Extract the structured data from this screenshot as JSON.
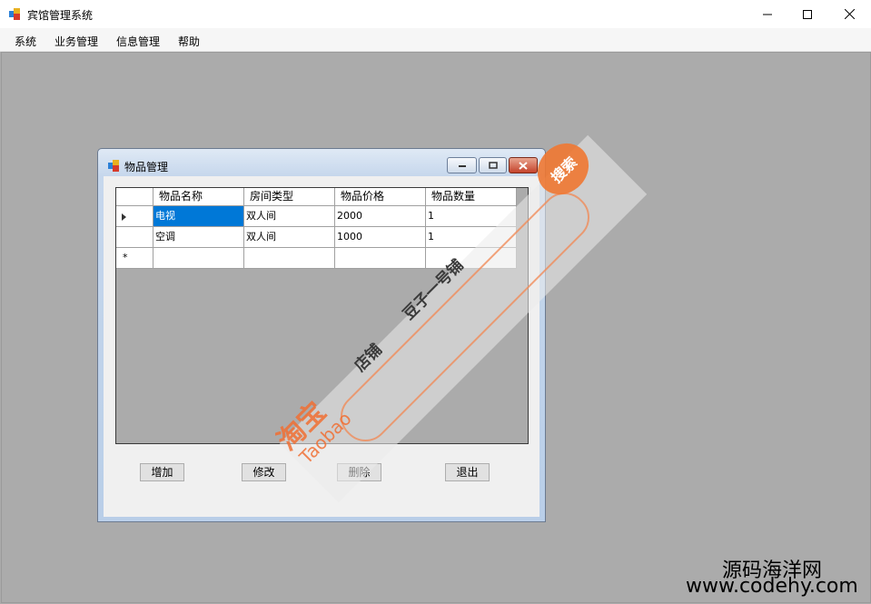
{
  "window": {
    "title": "宾馆管理系统"
  },
  "menu": [
    "系统",
    "业务管理",
    "信息管理",
    "帮助"
  ],
  "child_window": {
    "title": "物品管理"
  },
  "grid": {
    "columns": [
      "物品名称",
      "房间类型",
      "物品价格",
      "物品数量"
    ],
    "rows": [
      [
        "电视",
        "双人间",
        "2000",
        "1"
      ],
      [
        "空调",
        "双人间",
        "1000",
        "1"
      ]
    ],
    "new_row_marker": "*"
  },
  "buttons": {
    "add": "增加",
    "edit": "修改",
    "delete": "删除",
    "exit": "退出"
  },
  "watermark": {
    "brand": "淘宝",
    "brand_en": "Taobao",
    "shop_label": "店铺",
    "shop_name": "豆子一号铺",
    "search": "搜索"
  },
  "site": {
    "name": "源码海洋网",
    "url": "www.codehy.com"
  },
  "colors": {
    "selection": "#0078d7",
    "mdi_bg": "#ababab",
    "watermark_orange": "#f07032"
  }
}
